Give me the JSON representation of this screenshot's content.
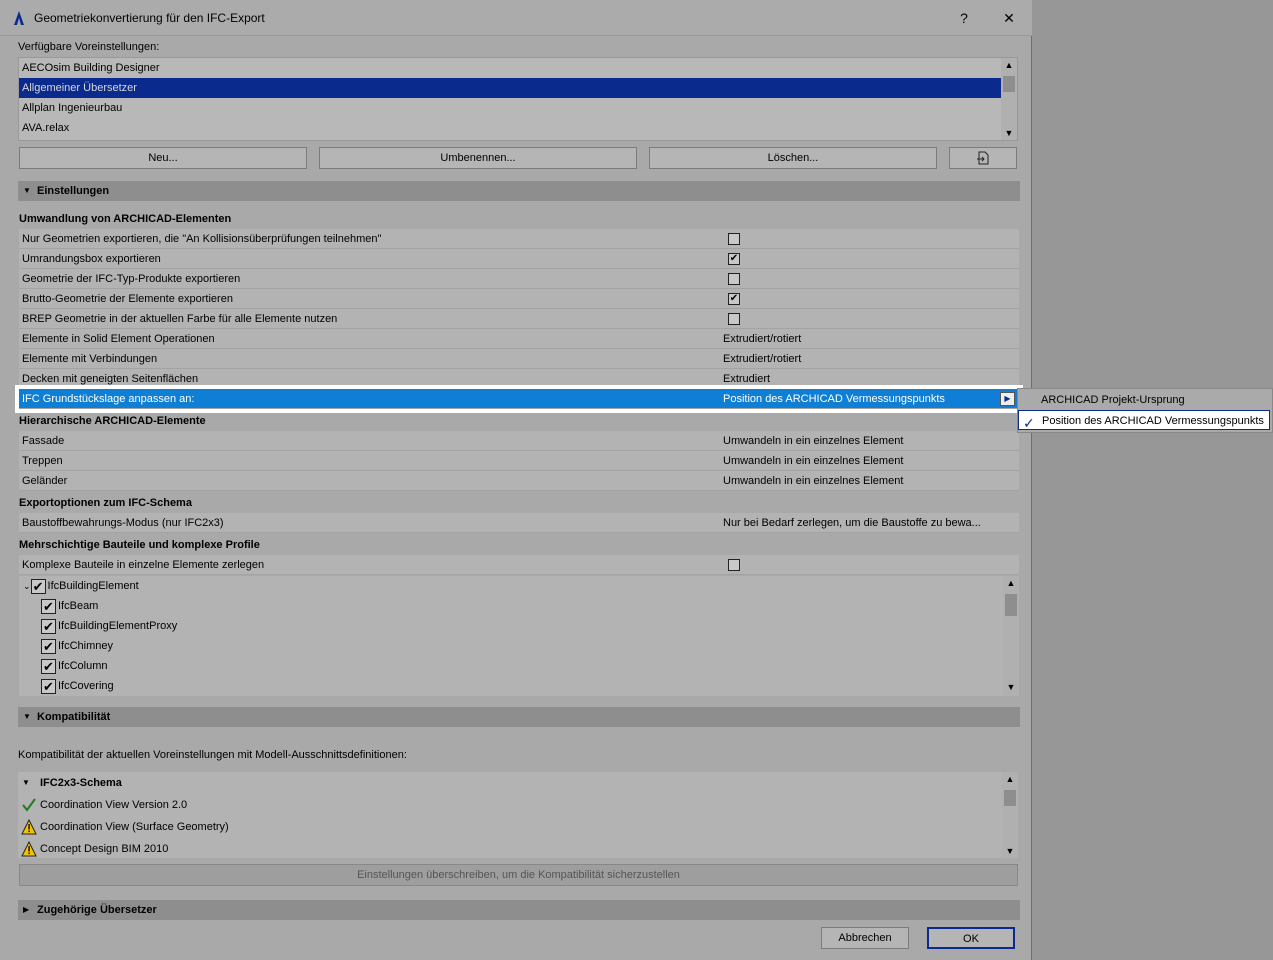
{
  "window": {
    "title": "Geometriekonvertierung für den IFC-Export",
    "help_label": "?",
    "close_label": "✕"
  },
  "presets": {
    "label": "Verfügbare Voreinstellungen:",
    "items": [
      "AECOsim Building Designer",
      "Allgemeiner Übersetzer",
      "Allplan Ingenieurbau",
      "AVA.relax"
    ],
    "selected": "Allgemeiner Übersetzer",
    "buttons": {
      "new": "Neu...",
      "rename": "Umbenennen...",
      "delete": "Löschen..."
    }
  },
  "settings": {
    "header": "Einstellungen",
    "group1": {
      "title": "Umwandlung von ARCHICAD-Elementen",
      "rows": [
        {
          "label": "Nur Geometrien exportieren, die \"An Kollisionsüberprüfungen teilnehmen\"",
          "checked": false
        },
        {
          "label": "Umrandungsbox exportieren",
          "checked": true
        },
        {
          "label": "Geometrie der IFC-Typ-Produkte exportieren",
          "checked": false
        },
        {
          "label": "Brutto-Geometrie der Elemente exportieren",
          "checked": true
        },
        {
          "label": "BREP Geometrie in der aktuellen Farbe für alle Elemente nutzen",
          "checked": false
        },
        {
          "label": "Elemente in Solid Element Operationen",
          "value": "Extrudiert/rotiert"
        },
        {
          "label": "Elemente mit Verbindungen",
          "value": "Extrudiert/rotiert"
        },
        {
          "label": "Decken mit geneigten Seitenflächen",
          "value": "Extrudiert"
        },
        {
          "label": "IFC Grundstückslage anpassen an:",
          "value": "Position des ARCHICAD Vermessungspunkts"
        }
      ]
    },
    "group2": {
      "title": "Hierarchische ARCHICAD-Elemente",
      "rows": [
        {
          "label": "Fassade",
          "value": "Umwandeln in ein einzelnes Element"
        },
        {
          "label": "Treppen",
          "value": "Umwandeln in ein einzelnes Element"
        },
        {
          "label": "Geländer",
          "value": "Umwandeln in ein einzelnes Element"
        }
      ]
    },
    "group3": {
      "title": "Exportoptionen zum IFC-Schema",
      "rows": [
        {
          "label": "Baustoffbewahrungs-Modus (nur IFC2x3)",
          "value": "Nur bei Bedarf zerlegen, um die Baustoffe zu bewa..."
        }
      ]
    },
    "group4": {
      "title": "Mehrschichtige Bauteile und komplexe Profile",
      "rows": [
        {
          "label": "Komplexe Bauteile in einzelne Elemente zerlegen",
          "checked": false
        }
      ],
      "tree": {
        "root": "IfcBuildingElement",
        "children": [
          "IfcBeam",
          "IfcBuildingElementProxy",
          "IfcChimney",
          "IfcColumn",
          "IfcCovering"
        ]
      }
    }
  },
  "popup": {
    "items": [
      "ARCHICAD Projekt-Ursprung",
      "Position des ARCHICAD Vermessungspunkts"
    ],
    "selected": "Position des ARCHICAD Vermessungspunkts"
  },
  "compatibility": {
    "header": "Kompatibilität",
    "description": "Kompatibilität der aktuellen Voreinstellungen mit Modell-Ausschnittsdefinitionen:",
    "schema": "IFC2x3-Schema",
    "items": [
      {
        "label": "Coordination View Version 2.0",
        "status": "ok"
      },
      {
        "label": "Coordination View (Surface Geometry)",
        "status": "warning"
      },
      {
        "label": "Concept Design BIM 2010",
        "status": "warning"
      }
    ],
    "override_button": "Einstellungen überschreiben, um die Kompatibilität sicherzustellen"
  },
  "related": {
    "header": "Zugehörige Übersetzer"
  },
  "footer": {
    "cancel": "Abbrechen",
    "ok": "OK"
  },
  "colors": {
    "selection": "#0a2a8e",
    "highlight_row": "#0f7fd6",
    "dialog_bg": "#a9a9a9"
  }
}
